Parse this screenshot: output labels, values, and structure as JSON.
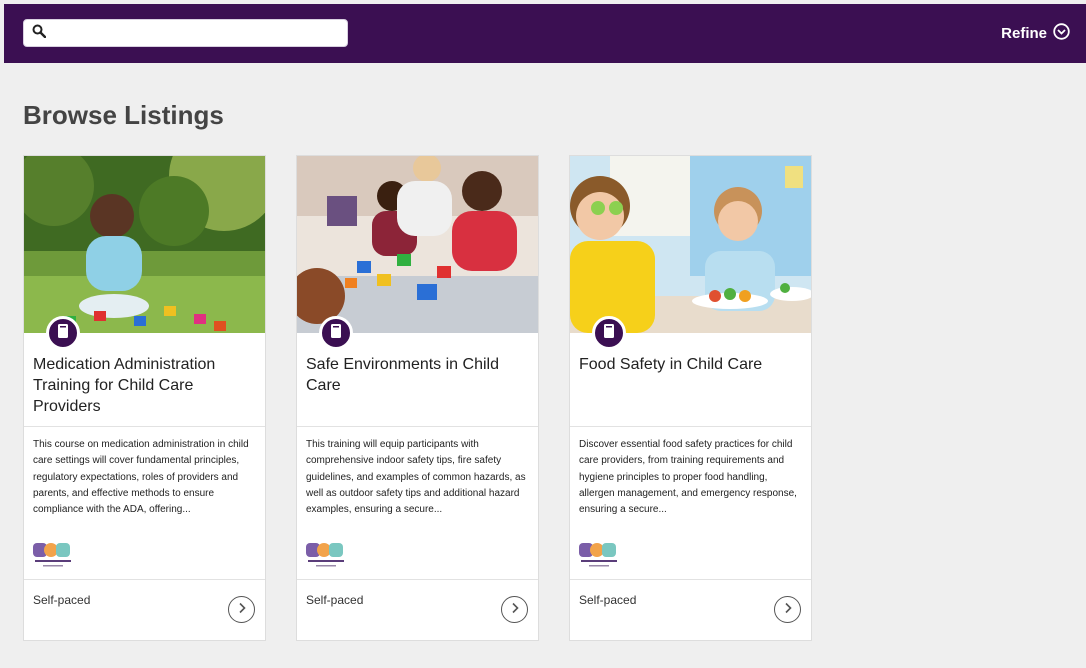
{
  "header": {
    "search_placeholder": "",
    "search_value": "",
    "refine_label": "Refine"
  },
  "page": {
    "title": "Browse Listings"
  },
  "cards": [
    {
      "title": "Medication Administration Training for Child Care Providers",
      "description": "This course on medication administration in child care settings will cover fundamental principles, regulatory expectations, roles of providers and parents, and effective methods to ensure compliance with the ADA, offering...",
      "pace": "Self-paced",
      "image": "baby-with-blocks-photo"
    },
    {
      "title": "Safe Environments in Child Care",
      "description": "This training will equip participants with comprehensive indoor safety tips, fire safety guidelines, and examples of common hazards, as well as outdoor safety tips and additional hazard examples, ensuring a secure...",
      "pace": "Self-paced",
      "image": "toddlers-playing-photo"
    },
    {
      "title": "Food Safety in Child Care",
      "description": "Discover essential food safety practices for child care providers, from training requirements and hygiene principles to proper food handling, allergen management, and emergency response, ensuring a secure...",
      "pace": "Self-paced",
      "image": "kids-eating-vegetables-photo"
    }
  ],
  "colors": {
    "brand": "#3b0f52",
    "background": "#efefef",
    "card": "#ffffff"
  }
}
